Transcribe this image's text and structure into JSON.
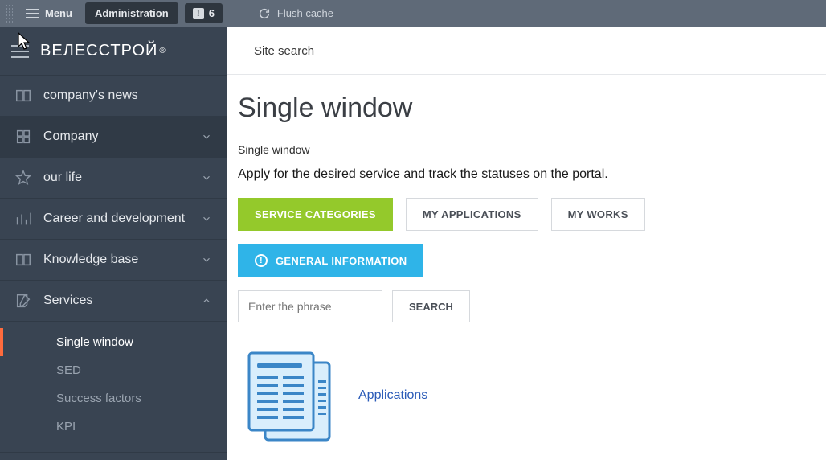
{
  "admin_bar": {
    "menu_label": "Menu",
    "administration": "Administration",
    "notif_count": "6",
    "flush_cache": "Flush cache"
  },
  "logo_text": "ВЕЛЕССТРОЙ",
  "sidebar": {
    "items": [
      {
        "label": "company's news",
        "icon": "book-icon",
        "expandable": false
      },
      {
        "label": "Company",
        "icon": "grid-icon",
        "expandable": true
      },
      {
        "label": "our life",
        "icon": "star-icon",
        "expandable": true
      },
      {
        "label": "Career and development",
        "icon": "chart-icon",
        "expandable": true
      },
      {
        "label": "Knowledge base",
        "icon": "book2-icon",
        "expandable": true
      },
      {
        "label": "Services",
        "icon": "edit-icon",
        "expandable": true,
        "open": true
      }
    ],
    "services_sub": [
      {
        "label": "Single window",
        "active": true
      },
      {
        "label": "SED"
      },
      {
        "label": "Success factors"
      },
      {
        "label": "KPI"
      }
    ]
  },
  "main": {
    "site_search": "Site search",
    "title": "Single window",
    "breadcrumb": "Single window",
    "description": "Apply for the desired service and track the statuses on the portal.",
    "tabs": {
      "categories": "SERVICE CATEGORIES",
      "my_apps": "MY APPLICATIONS",
      "my_works": "MY WORKS",
      "general_info": "GENERAL INFORMATION"
    },
    "search": {
      "placeholder": "Enter the phrase",
      "button": "SEARCH"
    },
    "applications_label": "Applications"
  }
}
